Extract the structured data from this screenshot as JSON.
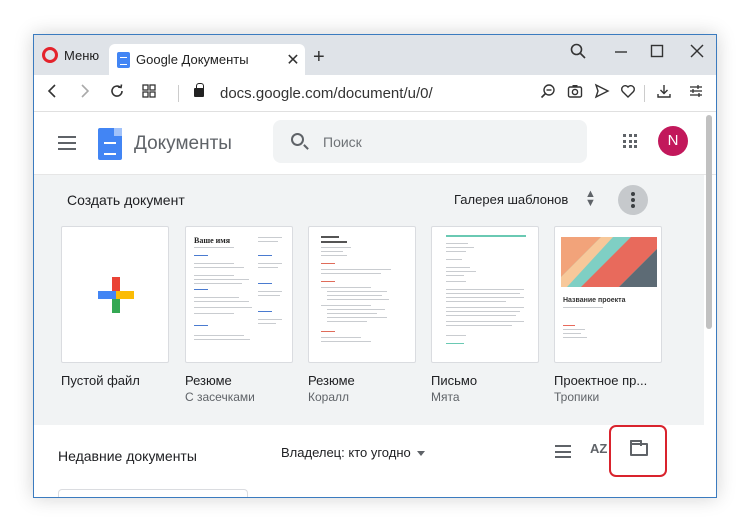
{
  "browser": {
    "menu_label": "Меню",
    "tab_title": "Google Документы",
    "tab_close": "✕",
    "new_tab": "+",
    "url": "docs.google.com/document/u/0/"
  },
  "app": {
    "title": "Документы",
    "search_placeholder": "Поиск",
    "avatar_letter": "N"
  },
  "gallery": {
    "create_label": "Создать документ",
    "gallery_link": "Галерея шаблонов",
    "templates": [
      {
        "name": "Пустой файл",
        "sub": ""
      },
      {
        "name": "Резюме",
        "sub": "С засечками"
      },
      {
        "name": "Резюме",
        "sub": "Коралл"
      },
      {
        "name": "Письмо",
        "sub": "Мята"
      },
      {
        "name": "Проектное пр...",
        "sub": "Тропики"
      }
    ],
    "resume_name": "Ваше имя",
    "project_name": "Название проекта"
  },
  "recent": {
    "title": "Недавние документы",
    "owner_filter": "Владелец: кто угодно",
    "sort_label": "AZ"
  },
  "colors": {
    "accent_red": "#d9232d",
    "docs_blue": "#4285f4",
    "avatar": "#c2185b"
  }
}
